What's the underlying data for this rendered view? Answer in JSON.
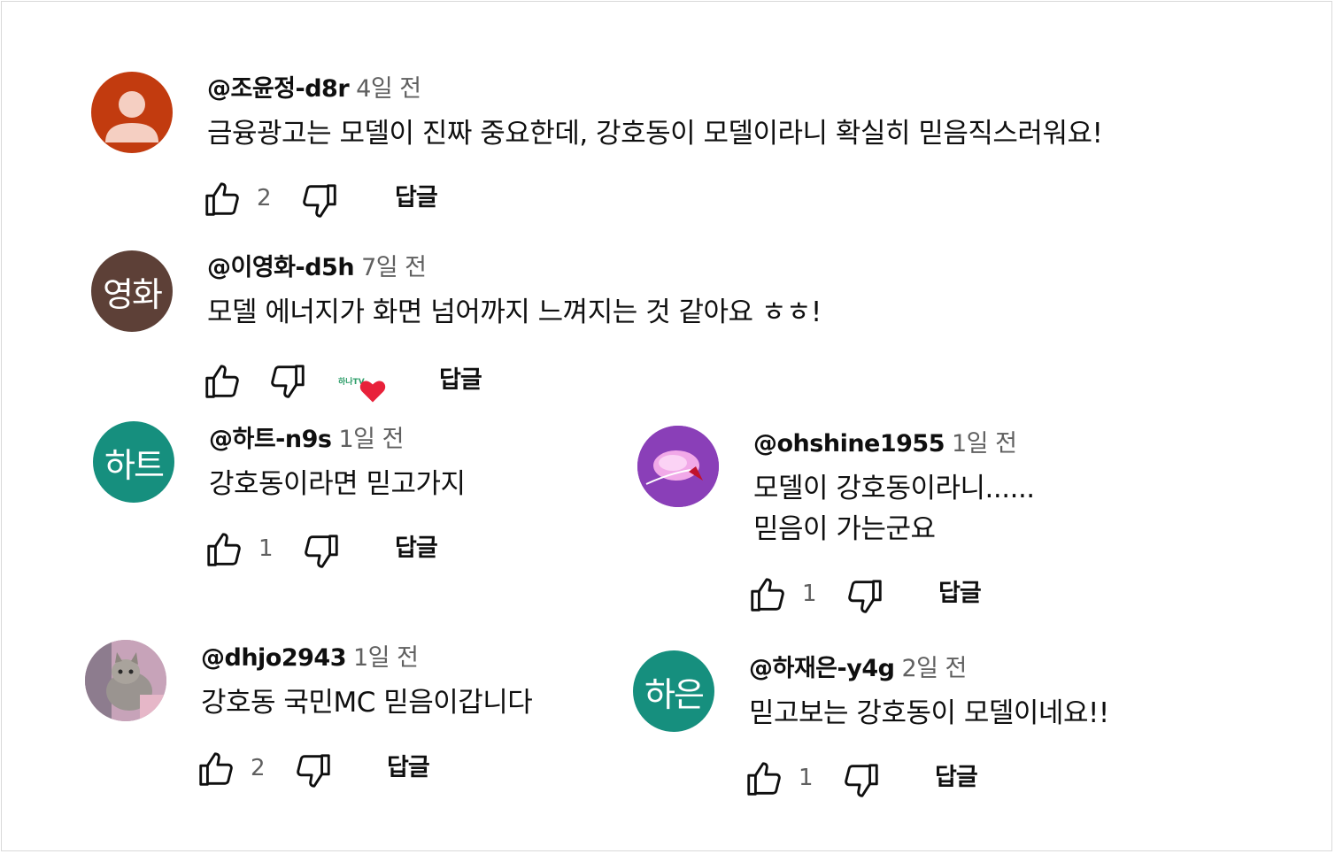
{
  "comments": [
    {
      "author": "@조윤정-d8r",
      "time": "4일 전",
      "text": "금융광고는 모델이 진짜 중요한데, 강호동이 모델이라니 확실히 믿음직스러워요!",
      "likes": "2",
      "reply_label": "답글",
      "avatar": {
        "type": "default-person",
        "color": "#c23b0f"
      }
    },
    {
      "author": "@이영화-d5h",
      "time": "7일 전",
      "text": "모델 에너지가 화면 넘어까지 느껴지는 것 같아요 ㅎㅎ!",
      "likes": "",
      "reply_label": "답글",
      "avatar": {
        "type": "initials",
        "text": "영화",
        "color": "#5d4037"
      },
      "creator_heart": {
        "channel_mark": "하나TV",
        "color": "#e8213a"
      }
    },
    {
      "author": "@하트-n9s",
      "time": "1일 전",
      "text": "강호동이라면 믿고가지",
      "likes": "1",
      "reply_label": "답글",
      "avatar": {
        "type": "initials",
        "text": "하트",
        "color": "#168f7e"
      }
    },
    {
      "author": "@ohshine1955",
      "time": "1일 전",
      "text_lines": [
        "모델이 강호동이라니......",
        "믿음이 가는군요"
      ],
      "likes": "1",
      "reply_label": "답글",
      "avatar": {
        "type": "image",
        "color": "#8a3fb8"
      }
    },
    {
      "author": "@dhjo2943",
      "time": "1일 전",
      "text": "강호동 국민MC 믿음이갑니다",
      "likes": "2",
      "reply_label": "답글",
      "avatar": {
        "type": "image",
        "color": "#b79aa6"
      }
    },
    {
      "author": "@하재은-y4g",
      "time": "2일 전",
      "text": "믿고보는 강호동이 모델이네요!!",
      "likes": "1",
      "reply_label": "답글",
      "avatar": {
        "type": "initials",
        "text": "하은",
        "color": "#168f7e"
      }
    }
  ],
  "icons": {
    "like": "thumbs-up-icon",
    "dislike": "thumbs-down-icon",
    "heart": "heart-icon"
  }
}
